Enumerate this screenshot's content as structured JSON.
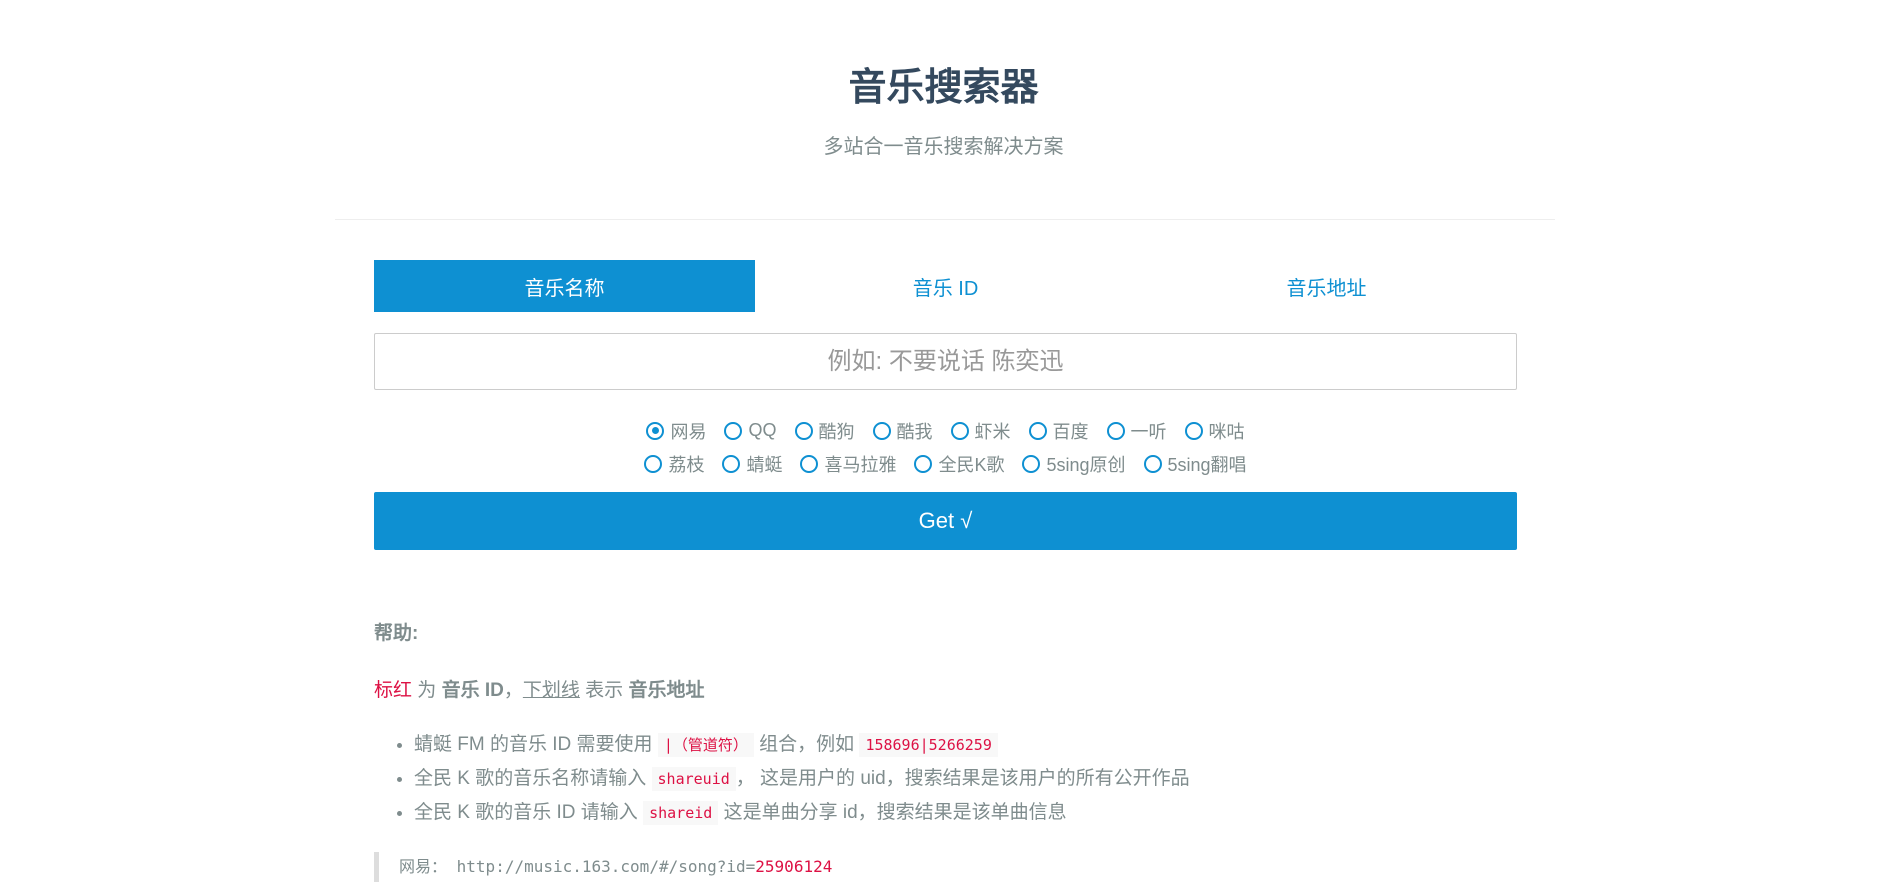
{
  "header": {
    "title": "音乐搜索器",
    "subtitle": "多站合一音乐搜索解决方案"
  },
  "tabs": [
    {
      "label": "音乐名称",
      "active": true
    },
    {
      "label": "音乐 ID"
    },
    {
      "label": "音乐地址"
    }
  ],
  "search": {
    "placeholder": "例如: 不要说话 陈奕迅",
    "value": ""
  },
  "sources_row1": [
    "网易",
    "QQ",
    "酷狗",
    "酷我",
    "虾米",
    "百度",
    "一听",
    "咪咕"
  ],
  "sources_row2": [
    "荔枝",
    "蜻蜓",
    "喜马拉雅",
    "全民K歌",
    "5sing原创",
    "5sing翻唱"
  ],
  "selected_source": "网易",
  "submit_label": "Get √",
  "help": {
    "heading": "帮助:",
    "legend": {
      "red": "标红",
      "t1": " 为 ",
      "b1": "音乐 ID",
      "t2": "，",
      "underline": "下划线",
      "t3": " 表示 ",
      "b2": "音乐地址"
    },
    "items": [
      {
        "a": "蜻蜓 FM 的音乐 ID 需要使用 ",
        "code1": "|（管道符）",
        "b": " 组合，例如 ",
        "code2": "158696|5266259"
      },
      {
        "a": "全民 K 歌的音乐名称请输入 ",
        "code1": "shareuid",
        "b": "， 这是用户的 uid，搜索结果是该用户的所有公开作品"
      },
      {
        "a": "全民 K 歌的音乐 ID 请输入 ",
        "code1": "shareid",
        "b": " 这是单曲分享 id，搜索结果是该单曲信息"
      }
    ],
    "example": {
      "label": "网易：",
      "url_prefix": "http://music.163.com/#/song?id=",
      "url_id": "25906124"
    }
  },
  "colors": {
    "accent": "#0e90d2",
    "red": "#dd1144",
    "title": "#34495e"
  }
}
